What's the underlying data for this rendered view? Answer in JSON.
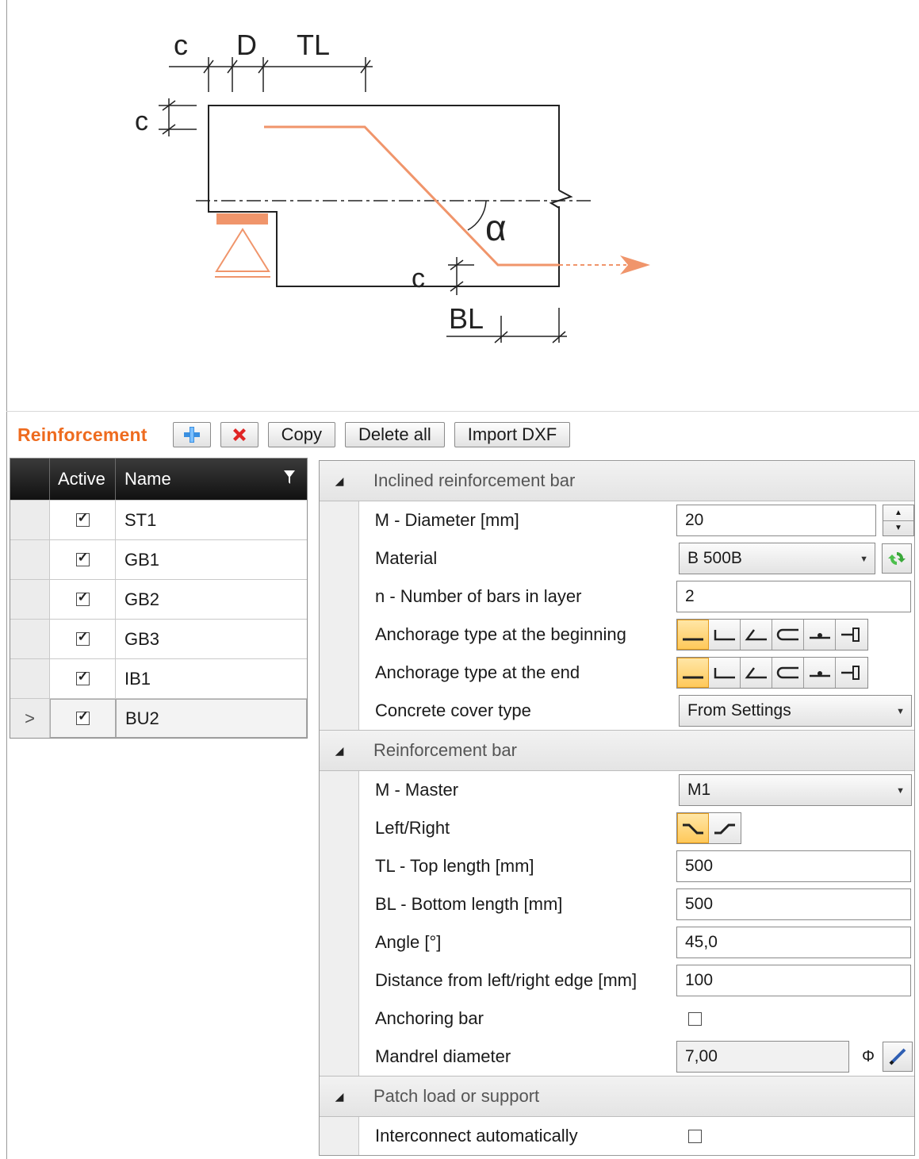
{
  "diagram": {
    "dim_labels": {
      "c_top": "c",
      "d": "D",
      "tl": "TL",
      "c_left": "c",
      "alpha": "α",
      "c_bottom": "c",
      "bl": "BL"
    },
    "colors": {
      "bar": "#f0956b",
      "outline": "#222222"
    }
  },
  "toolbar": {
    "title": "Reinforcement",
    "add_icon": "plus-icon",
    "delete_icon": "red-x-icon",
    "copy_label": "Copy",
    "delete_all_label": "Delete all",
    "import_dxf_label": "Import DXF",
    "title_color": "#ee6b1f"
  },
  "grid": {
    "columns": [
      "Active",
      "Name"
    ],
    "rows": [
      {
        "indicator": "",
        "active": true,
        "name": "ST1"
      },
      {
        "indicator": "",
        "active": true,
        "name": "GB1"
      },
      {
        "indicator": "",
        "active": true,
        "name": "GB2"
      },
      {
        "indicator": "",
        "active": true,
        "name": "GB3"
      },
      {
        "indicator": "",
        "active": true,
        "name": "IB1"
      },
      {
        "indicator": ">",
        "active": true,
        "name": "BU2"
      }
    ]
  },
  "props": {
    "inclined": {
      "title": "Inclined reinforcement bar",
      "diameter_label": "M - Diameter [mm]",
      "diameter_value": "20",
      "material_label": "Material",
      "material_value": "B 500B",
      "nbars_label": "n - Number of bars in layer",
      "nbars_value": "2",
      "anchor_begin_label": "Anchorage type at the beginning",
      "anchor_end_label": "Anchorage type at the end",
      "cover_label": "Concrete cover type",
      "cover_value": "From Settings"
    },
    "bar": {
      "title": "Reinforcement bar",
      "master_label": "M - Master",
      "master_value": "M1",
      "leftright_label": "Left/Right",
      "tl_label": "TL - Top length [mm]",
      "tl_value": "500",
      "bl_label": "BL - Bottom length [mm]",
      "bl_value": "500",
      "angle_label": "Angle [°]",
      "angle_value": "45,0",
      "distance_label": "Distance from left/right edge [mm]",
      "distance_value": "100",
      "anchoring_label": "Anchoring bar",
      "anchoring_checked": false,
      "mandrel_label": "Mandrel diameter",
      "mandrel_value": "7,00",
      "mandrel_unit": "Φ"
    },
    "patch": {
      "title": "Patch load or support",
      "interconnect_label": "Interconnect automatically",
      "interconnect_checked": false
    }
  }
}
